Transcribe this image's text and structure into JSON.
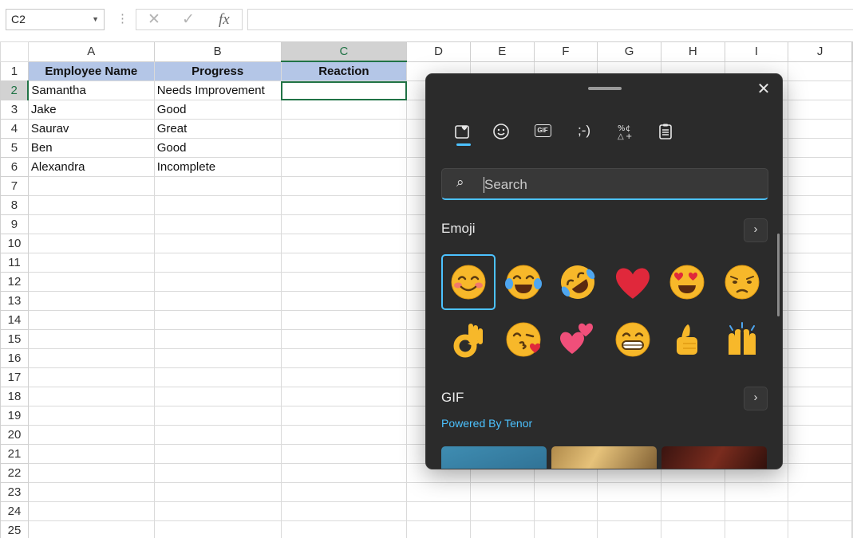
{
  "formula_bar": {
    "name_box": "C2",
    "cancel_glyph": "✕",
    "enter_glyph": "✓",
    "fx_glyph": "fx",
    "formula_value": ""
  },
  "sheet": {
    "columns": [
      "A",
      "B",
      "C",
      "D",
      "E",
      "F",
      "G",
      "H",
      "I",
      "J"
    ],
    "selected_column": "C",
    "selected_row": 2,
    "rows": [
      1,
      2,
      3,
      4,
      5,
      6,
      7,
      8,
      9,
      10,
      11,
      12,
      13,
      14,
      15,
      16,
      17,
      18,
      19,
      20,
      21,
      22,
      23,
      24,
      25
    ],
    "headers": {
      "a": "Employee Name",
      "b": "Progress",
      "c": "Reaction"
    },
    "records": [
      {
        "name": "Samantha",
        "progress": "Needs Improvement"
      },
      {
        "name": "Jake",
        "progress": "Good"
      },
      {
        "name": "Saurav",
        "progress": "Great"
      },
      {
        "name": "Ben",
        "progress": "Good"
      },
      {
        "name": "Alexandra",
        "progress": "Incomplete"
      }
    ]
  },
  "emoji_panel": {
    "close_glyph": "✕",
    "tabs": [
      {
        "icon": "favorites-icon",
        "active": true
      },
      {
        "icon": "emoji-icon",
        "active": false
      },
      {
        "icon": "gif-icon",
        "active": false,
        "label": "GIF"
      },
      {
        "icon": "kaomoji-icon",
        "active": false,
        "label": ";-)"
      },
      {
        "icon": "symbols-icon",
        "active": false
      },
      {
        "icon": "clipboard-icon",
        "active": false
      }
    ],
    "search_placeholder": "Search",
    "emoji_section_title": "Emoji",
    "gif_section_title": "GIF",
    "powered_by": "Powered By Tenor",
    "more_glyph": "›",
    "emojis": [
      "smiling-face-with-smiling-eyes",
      "face-with-tears-of-joy",
      "rolling-on-the-floor-laughing",
      "red-heart",
      "smiling-face-with-heart-eyes",
      "pensive-face",
      "ok-hand",
      "face-blowing-a-kiss",
      "two-hearts",
      "beaming-face",
      "thumbs-up",
      "raising-hands"
    ],
    "colors": {
      "accent": "#4cc2ff",
      "panel_bg": "#2b2b2b",
      "emoji_yellow": "#f7b82a",
      "heart_red": "#e0283b"
    }
  }
}
